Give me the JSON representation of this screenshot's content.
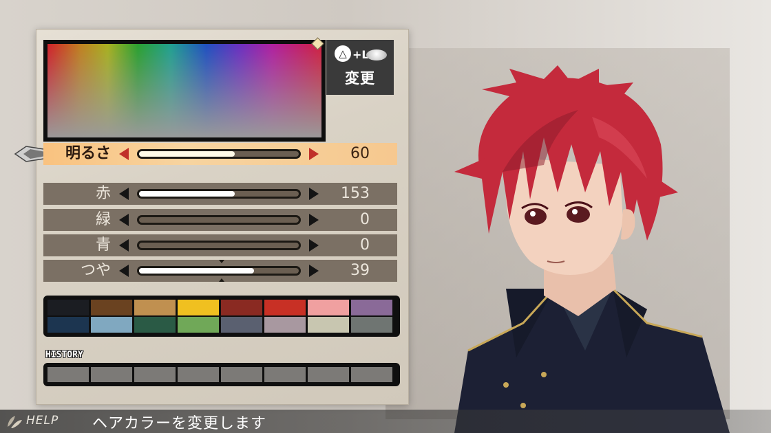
{
  "change_box": {
    "button_symbol": "△",
    "plus_label": "+L",
    "label": "変更"
  },
  "sliders": [
    {
      "label": "明るさ",
      "value": "60",
      "fraction": 0.6,
      "active": true
    },
    {
      "label": "赤",
      "value": "153",
      "fraction": 0.6,
      "active": false
    },
    {
      "label": "緑",
      "value": "0",
      "fraction": 0.0,
      "active": false
    },
    {
      "label": "青",
      "value": "0",
      "fraction": 0.0,
      "active": false
    },
    {
      "label": "つや",
      "value": "39",
      "fraction": 0.72,
      "active": false
    }
  ],
  "palette": {
    "row1": [
      "#1b1d22",
      "#6a4220",
      "#c09050",
      "#f0c020",
      "#8a2a22",
      "#c83025",
      "#f0a0a0",
      "#8a6a98"
    ],
    "row2": [
      "#1c3550",
      "#80a8c0",
      "#2a5a45",
      "#70a858",
      "#5a6070",
      "#a898a0",
      "#c8c6b0",
      "#6f7572"
    ]
  },
  "history": {
    "title": "HISTORY",
    "slot_color": "#7c7a77"
  },
  "helpbar": {
    "label": "HELP",
    "text": "ヘアカラーを変更します"
  },
  "colors": {
    "hair": "#c42a3c",
    "hair_dark": "#8a1a2a",
    "skin": "#f3d2bf",
    "jacket": "#1c2034",
    "trim": "#c8a858"
  }
}
